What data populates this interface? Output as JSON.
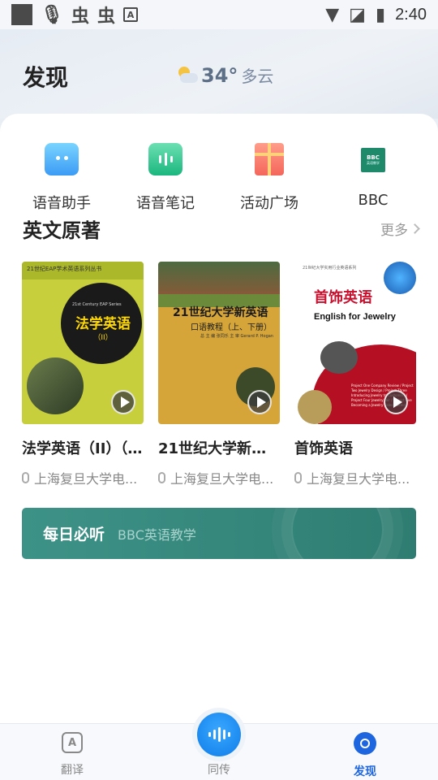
{
  "status_bar": {
    "time": "2:40",
    "glyph_a": "A",
    "bug1": "虫",
    "bug2": "虫"
  },
  "header": {
    "title": "发现",
    "temperature": "34°",
    "weather": "多云"
  },
  "quick_actions": [
    {
      "label": "语音助手",
      "icon": "robot-chat-icon"
    },
    {
      "label": "语音笔记",
      "icon": "voice-note-icon"
    },
    {
      "label": "活动广场",
      "icon": "gift-icon"
    },
    {
      "label": "BBC",
      "icon": "bbc-icon"
    }
  ],
  "bbc_icon_text": {
    "brand": "BBC",
    "sub": "英语教学"
  },
  "section": {
    "title": "英文原著",
    "more": "更多"
  },
  "books": [
    {
      "title": "法学英语（II）（...",
      "publisher": "上海复旦大学电...",
      "cover": {
        "series": "21世纪EAP学术英语系列丛书",
        "series_en": "21st Century EAP Series",
        "title": "法学英语",
        "subtitle": "（II）"
      }
    },
    {
      "title": "21世纪大学新英...",
      "publisher": "上海复旦大学电...",
      "cover": {
        "title": "21世纪大学新英语",
        "subtitle": "口语教程（上、下册）",
        "authors": "总 主 编 张同乐   主 审 Gerard P. Hogan"
      }
    },
    {
      "title": "首饰英语",
      "publisher": "上海复旦大学电...",
      "cover": {
        "top": "21世纪大学实用行业英语系列",
        "title": "首饰英语",
        "title_en": "English for Jewelry",
        "lines": "Project One Company Review / Project Two Jewelry Design / Project Three Introducing Jewelry to Customers / Project Four Jewelry Fair / Project Five Becoming a Jewelry Sales Master"
      }
    }
  ],
  "banner": {
    "title": "每日必听",
    "subtitle": "BBC英语教学"
  },
  "nav": {
    "translate": "翻译",
    "translate_glyph": "A",
    "simul": "同传",
    "discover": "发现"
  },
  "colors": {
    "accent": "#1e66e0",
    "banner": "#3d9287"
  }
}
